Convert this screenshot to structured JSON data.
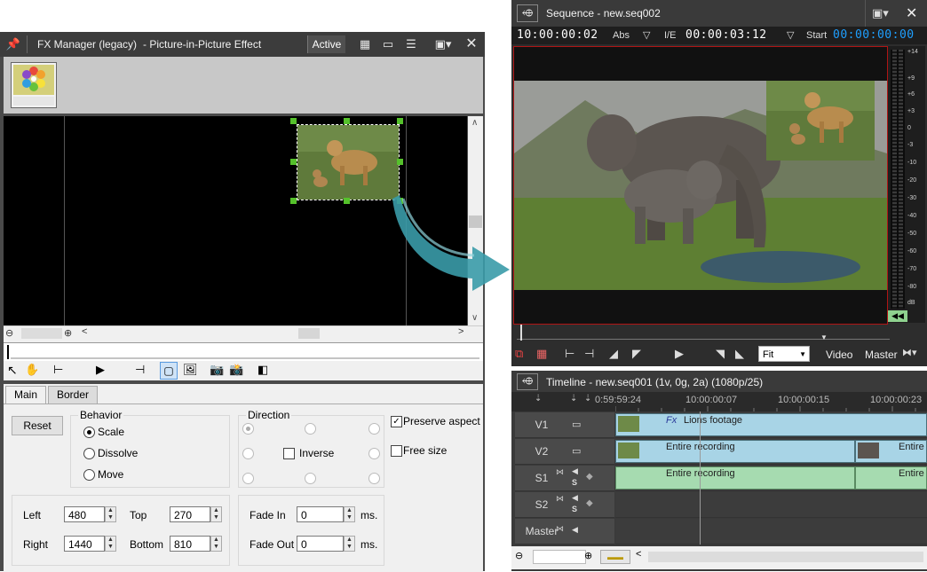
{
  "fx": {
    "title": "FX Manager (legacy)",
    "subtitle": "- Picture-in-Picture Effect",
    "active_label": "Active",
    "tabs": [
      "Main",
      "Border"
    ],
    "reset_label": "Reset",
    "behavior_label": "Behavior",
    "behavior_options": [
      "Scale",
      "Dissolve",
      "Move"
    ],
    "direction_label": "Direction",
    "inverse_label": "Inverse",
    "preserve_aspect_label": "Preserve aspect",
    "free_size_label": "Free size",
    "left_label": "Left",
    "left_value": "480",
    "top_label": "Top",
    "top_value": "270",
    "right_label": "Right",
    "right_value": "1440",
    "bottom_label": "Bottom",
    "bottom_value": "810",
    "fade_in_label": "Fade In",
    "fade_in_value": "0",
    "fade_out_label": "Fade Out",
    "fade_out_value": "0",
    "ms_label": "ms."
  },
  "sequence": {
    "title": "Sequence - new.seq002",
    "current_tc": "10:00:00:02",
    "abs_label": "Abs",
    "ie_label": "I/E",
    "duration_tc": "00:00:03:12",
    "start_label": "Start",
    "start_tc": "00:00:00:00",
    "fit_label": "Fit",
    "video_label": "Video",
    "master_label": "Master",
    "meter_scale": [
      "+14",
      "+9",
      "+6",
      "+3",
      "0",
      "-3",
      "-10",
      "-20",
      "-30",
      "-40",
      "-50",
      "-60",
      "-70",
      "-80",
      "dB"
    ]
  },
  "timeline": {
    "title": "Timeline - new.seq001 (1v, 0g, 2a) (1080p/25)",
    "ruler_labels": [
      "0:59:59:24",
      "10:00:00:07",
      "10:00:00:15",
      "10:00:00:23"
    ],
    "tracks": [
      "V1",
      "V2",
      "S1",
      "S2",
      "Master"
    ],
    "clips": {
      "v1": "Lions footage",
      "v2a": "Entire recording",
      "v2b": "Entire",
      "s1a": "Entire recording",
      "s1b": "Entire"
    },
    "fx_tag": "Fx",
    "solo_label": "S"
  },
  "colors": {
    "accent_blue": "#1e9fff",
    "clip_video": "#a8d4e6",
    "clip_audio": "#a6dbb0",
    "handle_green": "#55c12b",
    "arrow_teal": "#3a9ba8",
    "border_red": "#b01515"
  }
}
